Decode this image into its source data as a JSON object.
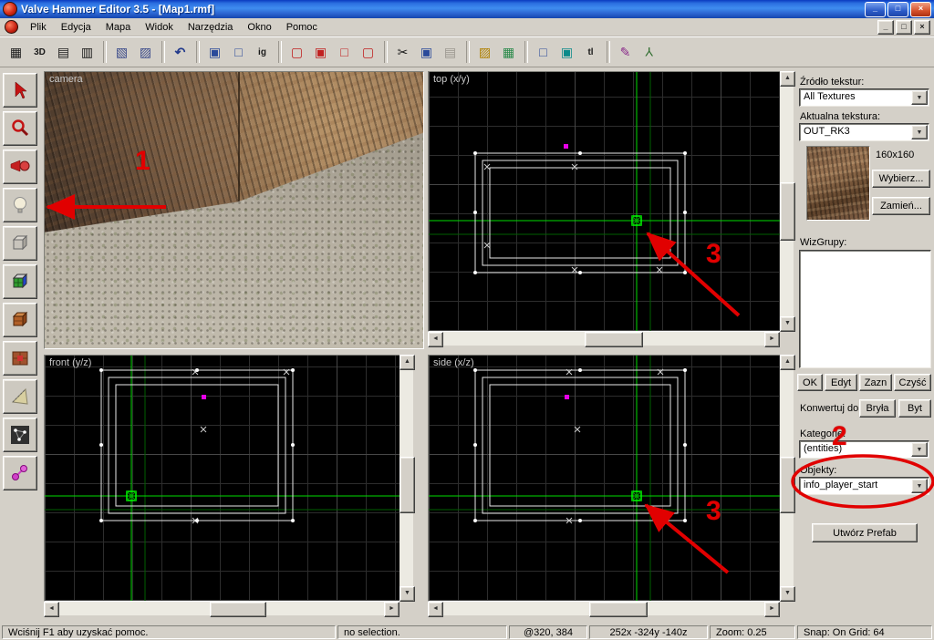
{
  "window": {
    "title": "Valve Hammer Editor 3.5 - [Map1.rmf]",
    "minimize_glyph": "_",
    "restore_glyph": "□",
    "close_glyph": "×"
  },
  "menu": {
    "items": [
      "Plik",
      "Edycja",
      "Mapa",
      "Widok",
      "Narzędzia",
      "Okno",
      "Pomoc"
    ]
  },
  "mdi": {
    "minimize_glyph": "_",
    "restore_glyph": "□",
    "close_glyph": "×"
  },
  "toolbar": {
    "icons": [
      {
        "name": "grid-toggle",
        "glyph": "▦"
      },
      {
        "name": "grid-3d",
        "glyph": "3D"
      },
      {
        "name": "grid-smaller",
        "glyph": "▤"
      },
      {
        "name": "grid-larger",
        "glyph": "▥"
      },
      {
        "name": "cascade-windows",
        "glyph": "▧"
      },
      {
        "name": "tile-windows",
        "glyph": "▨"
      },
      {
        "name": "undo",
        "glyph": "↶"
      },
      {
        "name": "select-objects",
        "glyph": "▣"
      },
      {
        "name": "select-group",
        "glyph": "□"
      },
      {
        "name": "ignore-groups",
        "glyph": "ig"
      },
      {
        "name": "carve",
        "glyph": "▢"
      },
      {
        "name": "group",
        "glyph": "▣"
      },
      {
        "name": "ungroup",
        "glyph": "□"
      },
      {
        "name": "cordon",
        "glyph": "▢"
      },
      {
        "name": "cut",
        "glyph": "✂"
      },
      {
        "name": "copy",
        "glyph": "▣"
      },
      {
        "name": "paste",
        "glyph": "▤"
      },
      {
        "name": "texture-bars",
        "glyph": "▨"
      },
      {
        "name": "texture-bars-alt",
        "glyph": "▦"
      },
      {
        "name": "selection-box",
        "glyph": "□"
      },
      {
        "name": "zoom-box",
        "glyph": "▣"
      },
      {
        "name": "texture-lock",
        "glyph": "tl"
      },
      {
        "name": "color-tool",
        "glyph": "✎"
      },
      {
        "name": "split-tool",
        "glyph": "Y"
      }
    ]
  },
  "icons": {
    "arrow_left": "◄",
    "arrow_right": "►",
    "arrow_up": "▲",
    "arrow_down": "▼"
  },
  "tools": {
    "items": [
      "selection",
      "magnify",
      "camera",
      "entity",
      "block",
      "toggle-textures",
      "apply-current-texture",
      "apply-decals",
      "clipping",
      "vertex-manipulation",
      "path"
    ]
  },
  "viewports": {
    "camera_label": "camera",
    "top_label": "top (x/y)",
    "front_label": "front (y/z)",
    "side_label": "side (x/z)"
  },
  "right_panel": {
    "texture_source_label": "Źródło tekstur:",
    "texture_source_value": "All Textures",
    "current_texture_label": "Aktualna tekstura:",
    "current_texture_value": "OUT_RK3",
    "texture_size": "160x160",
    "browse_button": "Wybierz...",
    "replace_button": "Zamień...",
    "groups_label": "WizGrupy:",
    "ok_button": "OK",
    "edit_button": "Edyt",
    "mark_button": "Zazn",
    "clear_button": "Czyść",
    "convert_label": "Konwertuj do:",
    "to_world_button": "Bryła",
    "to_entity_button": "Byt",
    "categories_label": "Kategorie:",
    "categories_value": "(entities)",
    "objects_label": "Objekty:",
    "objects_value": "info_player_start",
    "create_prefab_button": "Utwórz Prefab"
  },
  "status": {
    "help": "Wciśnij F1 aby uzyskać pomoc.",
    "selection": "no selection.",
    "cursor": "@320, 384",
    "size": "252x -324y -140z",
    "zoom": "Zoom: 0.25",
    "snap": "Snap: On Grid: 64"
  },
  "annotations": {
    "step1": "1",
    "step2": "2",
    "step3_top": "3",
    "step3_side": "3"
  },
  "colors": {
    "crosshair_green": "#00dd00",
    "annotation_red": "#e10000",
    "wire_white": "#e8e8e8",
    "entity_magenta": "#e800e8"
  }
}
